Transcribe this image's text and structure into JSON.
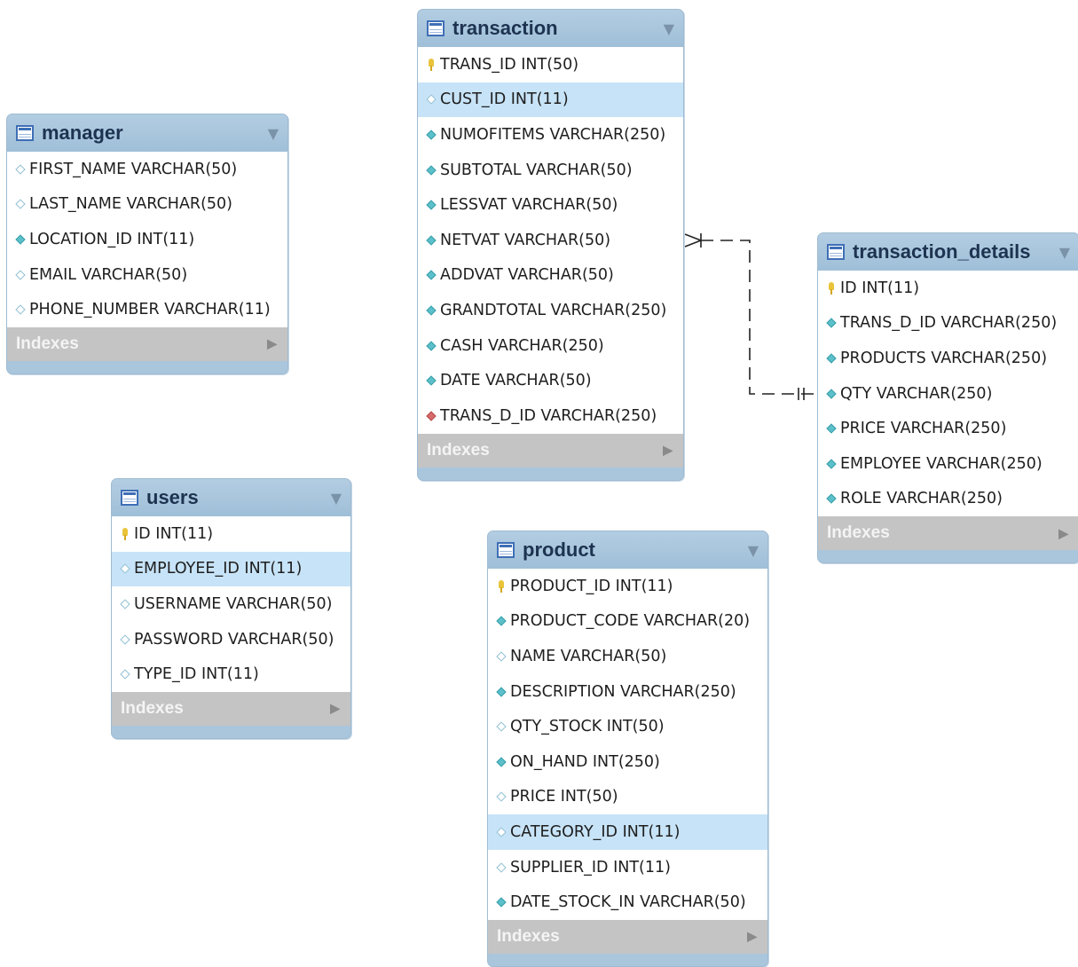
{
  "tables": {
    "transaction": {
      "name": "transaction",
      "indexes_label": "Indexes",
      "columns": [
        {
          "text": "TRANS_ID INT(50)",
          "icon": "primary-key-icon"
        },
        {
          "text": "CUST_ID INT(11)",
          "icon": "column-diamond-open-icon",
          "selected": true
        },
        {
          "text": "NUMOFITEMS VARCHAR(250)",
          "icon": "column-diamond-filled-icon"
        },
        {
          "text": "SUBTOTAL VARCHAR(50)",
          "icon": "column-diamond-filled-icon"
        },
        {
          "text": "LESSVAT VARCHAR(50)",
          "icon": "column-diamond-filled-icon"
        },
        {
          "text": "NETVAT VARCHAR(50)",
          "icon": "column-diamond-filled-icon"
        },
        {
          "text": "ADDVAT VARCHAR(50)",
          "icon": "column-diamond-filled-icon"
        },
        {
          "text": "GRANDTOTAL VARCHAR(250)",
          "icon": "column-diamond-filled-icon"
        },
        {
          "text": "CASH VARCHAR(250)",
          "icon": "column-diamond-filled-icon"
        },
        {
          "text": "DATE VARCHAR(50)",
          "icon": "column-diamond-filled-icon"
        },
        {
          "text": "TRANS_D_ID VARCHAR(250)",
          "icon": "foreign-key-diamond-icon"
        }
      ]
    },
    "manager": {
      "name": "manager",
      "indexes_label": "Indexes",
      "columns": [
        {
          "text": "FIRST_NAME VARCHAR(50)",
          "icon": "column-diamond-open-icon"
        },
        {
          "text": "LAST_NAME VARCHAR(50)",
          "icon": "column-diamond-open-icon"
        },
        {
          "text": "LOCATION_ID INT(11)",
          "icon": "column-diamond-filled-icon"
        },
        {
          "text": "EMAIL VARCHAR(50)",
          "icon": "column-diamond-open-icon"
        },
        {
          "text": "PHONE_NUMBER VARCHAR(11)",
          "icon": "column-diamond-open-icon"
        }
      ]
    },
    "transaction_details": {
      "name": "transaction_details",
      "indexes_label": "Indexes",
      "columns": [
        {
          "text": "ID INT(11)",
          "icon": "primary-key-icon"
        },
        {
          "text": "TRANS_D_ID VARCHAR(250)",
          "icon": "column-diamond-filled-icon"
        },
        {
          "text": "PRODUCTS VARCHAR(250)",
          "icon": "column-diamond-filled-icon"
        },
        {
          "text": "QTY VARCHAR(250)",
          "icon": "column-diamond-filled-icon"
        },
        {
          "text": "PRICE VARCHAR(250)",
          "icon": "column-diamond-filled-icon"
        },
        {
          "text": "EMPLOYEE VARCHAR(250)",
          "icon": "column-diamond-filled-icon"
        },
        {
          "text": "ROLE VARCHAR(250)",
          "icon": "column-diamond-filled-icon"
        }
      ]
    },
    "users": {
      "name": "users",
      "indexes_label": "Indexes",
      "columns": [
        {
          "text": "ID INT(11)",
          "icon": "primary-key-icon"
        },
        {
          "text": "EMPLOYEE_ID INT(11)",
          "icon": "column-diamond-open-icon",
          "selected": true
        },
        {
          "text": "USERNAME VARCHAR(50)",
          "icon": "column-diamond-open-icon"
        },
        {
          "text": "PASSWORD VARCHAR(50)",
          "icon": "column-diamond-open-icon"
        },
        {
          "text": "TYPE_ID INT(11)",
          "icon": "column-diamond-open-icon"
        }
      ]
    },
    "product": {
      "name": "product",
      "indexes_label": "Indexes",
      "columns": [
        {
          "text": "PRODUCT_ID INT(11)",
          "icon": "primary-key-icon"
        },
        {
          "text": "PRODUCT_CODE VARCHAR(20)",
          "icon": "column-diamond-filled-icon"
        },
        {
          "text": "NAME VARCHAR(50)",
          "icon": "column-diamond-open-icon"
        },
        {
          "text": "DESCRIPTION VARCHAR(250)",
          "icon": "column-diamond-filled-icon"
        },
        {
          "text": "QTY_STOCK INT(50)",
          "icon": "column-diamond-open-icon"
        },
        {
          "text": "ON_HAND INT(250)",
          "icon": "column-diamond-filled-icon"
        },
        {
          "text": "PRICE INT(50)",
          "icon": "column-diamond-open-icon"
        },
        {
          "text": "CATEGORY_ID INT(11)",
          "icon": "column-diamond-open-icon",
          "selected": true
        },
        {
          "text": "SUPPLIER_ID INT(11)",
          "icon": "column-diamond-open-icon"
        },
        {
          "text": "DATE_STOCK_IN VARCHAR(50)",
          "icon": "column-diamond-filled-icon"
        }
      ]
    }
  },
  "relationships": [
    {
      "from": "transaction",
      "to": "transaction_details",
      "from_end": "many",
      "to_end": "one-mandatory",
      "style": "dashed"
    }
  ]
}
